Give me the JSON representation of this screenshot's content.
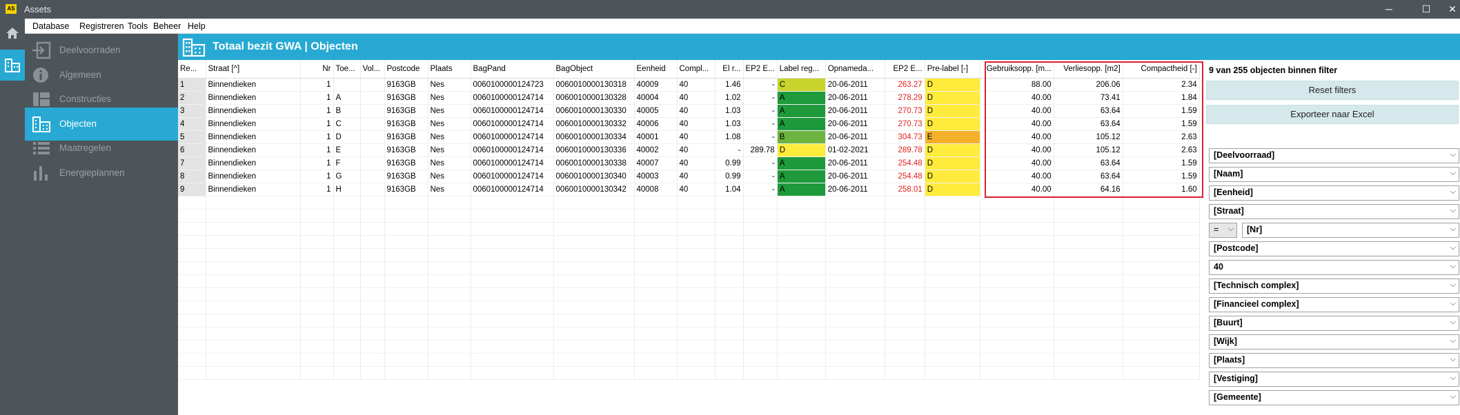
{
  "window": {
    "logo_text": "AS",
    "title": "Assets",
    "min": "─",
    "max": "☐",
    "close": "✕"
  },
  "menu": [
    "Database",
    "Registreren",
    "Tools",
    "Beheer",
    "Help"
  ],
  "sidebar": [
    {
      "label": "Deelvoorraden",
      "icon": "login-arrow-icon",
      "active": false
    },
    {
      "label": "Algemeen",
      "icon": "info-icon",
      "active": false
    },
    {
      "label": "Constructies",
      "icon": "layout-icon",
      "active": false
    },
    {
      "label": "Objecten",
      "icon": "buildings-icon",
      "active": true
    },
    {
      "label": "Maatregelen",
      "icon": "list-icon",
      "active": false
    },
    {
      "label": "Energieplannen",
      "icon": "bar-chart-icon",
      "active": false
    }
  ],
  "header": {
    "title": "Totaal bezit GWA | Objecten"
  },
  "table": {
    "columns": [
      "Re...",
      "Straat [^]",
      "Nr",
      "Toe...",
      "Vol...",
      "Postcode",
      "Plaats",
      "BagPand",
      "BagObject",
      "Eenheid",
      "Compl...",
      "El r...",
      "EP2 E...",
      "Label reg...",
      "Opnameda...",
      "EP2 E...",
      "Pre-label [-]",
      "Gebruiksopp. [m...",
      "Verliesopp. [m2]",
      "Compactheid [-]"
    ],
    "rows": [
      [
        "1",
        "Binnendieken",
        "1",
        "",
        "",
        "9163GB",
        "Nes",
        "0060100000124723",
        "0060010000130318",
        "40009",
        "40",
        "1.46",
        "-",
        "C",
        "20-06-2011",
        "263.27",
        "D",
        "88.00",
        "206.06",
        "2.34"
      ],
      [
        "2",
        "Binnendieken",
        "1",
        "A",
        "",
        "9163GB",
        "Nes",
        "0060100000124714",
        "0060010000130328",
        "40004",
        "40",
        "1.02",
        "-",
        "A",
        "20-06-2011",
        "278.29",
        "D",
        "40.00",
        "73.41",
        "1.84"
      ],
      [
        "3",
        "Binnendieken",
        "1",
        "B",
        "",
        "9163GB",
        "Nes",
        "0060100000124714",
        "0060010000130330",
        "40005",
        "40",
        "1.03",
        "-",
        "A",
        "20-06-2011",
        "270.73",
        "D",
        "40.00",
        "63.64",
        "1.59"
      ],
      [
        "4",
        "Binnendieken",
        "1",
        "C",
        "",
        "9163GB",
        "Nes",
        "0060100000124714",
        "0060010000130332",
        "40006",
        "40",
        "1.03",
        "-",
        "A",
        "20-06-2011",
        "270.73",
        "D",
        "40.00",
        "63.64",
        "1.59"
      ],
      [
        "5",
        "Binnendieken",
        "1",
        "D",
        "",
        "9163GB",
        "Nes",
        "0060100000124714",
        "0060010000130334",
        "40001",
        "40",
        "1.08",
        "-",
        "B",
        "20-06-2011",
        "304.73",
        "E",
        "40.00",
        "105.12",
        "2.63"
      ],
      [
        "6",
        "Binnendieken",
        "1",
        "E",
        "",
        "9163GB",
        "Nes",
        "0060100000124714",
        "0060010000130336",
        "40002",
        "40",
        "-",
        "289.78",
        "D",
        "01-02-2021",
        "289.78",
        "D",
        "40.00",
        "105.12",
        "2.63"
      ],
      [
        "7",
        "Binnendieken",
        "1",
        "F",
        "",
        "9163GB",
        "Nes",
        "0060100000124714",
        "0060010000130338",
        "40007",
        "40",
        "0.99",
        "-",
        "A",
        "20-06-2011",
        "254.48",
        "D",
        "40.00",
        "63.64",
        "1.59"
      ],
      [
        "8",
        "Binnendieken",
        "1",
        "G",
        "",
        "9163GB",
        "Nes",
        "0060100000124714",
        "0060010000130340",
        "40003",
        "40",
        "0.99",
        "-",
        "A",
        "20-06-2011",
        "254.48",
        "D",
        "40.00",
        "63.64",
        "1.59"
      ],
      [
        "9",
        "Binnendieken",
        "1",
        "H",
        "",
        "9163GB",
        "Nes",
        "0060100000124714",
        "0060010000130342",
        "40008",
        "40",
        "1.04",
        "-",
        "A",
        "20-06-2011",
        "258.01",
        "D",
        "40.00",
        "64.16",
        "1.60"
      ]
    ]
  },
  "panel": {
    "filter_count": "9 van 255 objecten binnen filter",
    "reset_button": "Reset filters",
    "export_button": "Exporteer naar Excel",
    "operator": "=",
    "filters": [
      "[Deelvoorraad]",
      "[Naam]",
      "[Eenheid]",
      "[Straat]",
      "[Nr]",
      "[Postcode]",
      "40",
      "[Technisch complex]",
      "[Financieel complex]",
      "[Buurt]",
      "[Wijk]",
      "[Plaats]",
      "[Vestiging]",
      "[Gemeente]"
    ]
  },
  "colors": {
    "accent": "#27a9d3",
    "chrome": "#4d545a",
    "label_A": "#1e9a3c",
    "label_B": "#6cb33f",
    "label_C": "#c9d42c",
    "label_D": "#ffeb3b",
    "label_E": "#f5b02a",
    "highlight": "#d9232e"
  }
}
